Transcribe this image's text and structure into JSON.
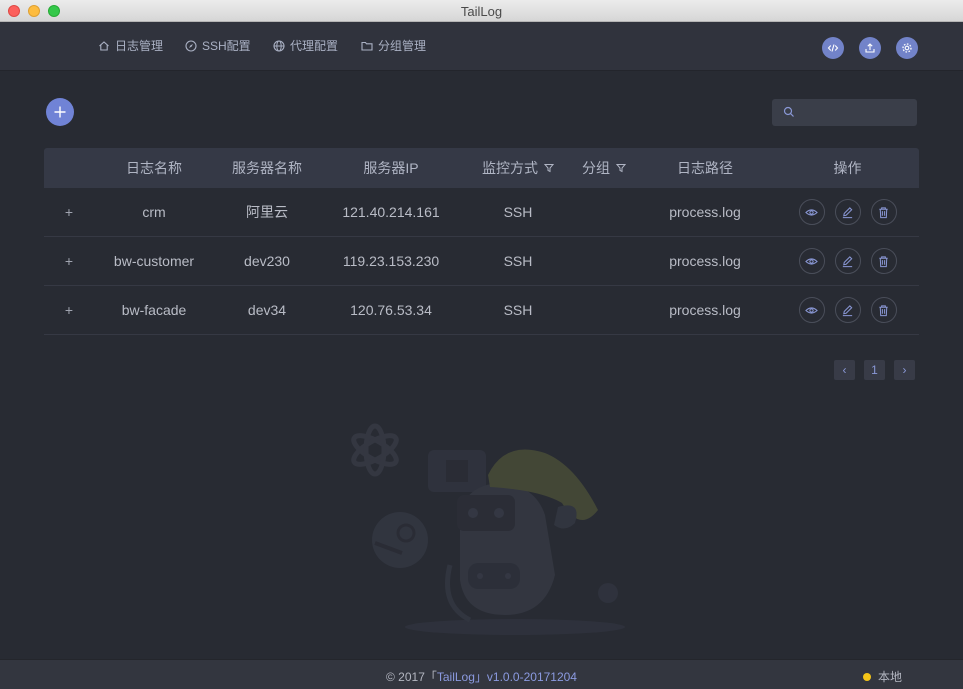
{
  "window": {
    "title": "TailLog"
  },
  "nav": [
    {
      "label": "日志管理",
      "icon": "home-icon"
    },
    {
      "label": "SSH配置",
      "icon": "compass-icon"
    },
    {
      "label": "代理配置",
      "icon": "globe-icon"
    },
    {
      "label": "分组管理",
      "icon": "folder-icon"
    }
  ],
  "header_actions": [
    "code-icon",
    "upload-icon",
    "gear-icon"
  ],
  "search": {
    "placeholder": "",
    "value": ""
  },
  "table": {
    "columns": [
      "日志名称",
      "服务器名称",
      "服务器IP",
      "监控方式",
      "分组",
      "日志路径",
      "操作"
    ],
    "rows": [
      {
        "expand": "+",
        "name": "crm",
        "server": "阿里云",
        "ip": "121.40.214.161",
        "method": "SSH",
        "group": "",
        "path": "process.log"
      },
      {
        "expand": "+",
        "name": "bw-customer",
        "server": "dev230",
        "ip": "119.23.153.230",
        "method": "SSH",
        "group": "",
        "path": "process.log"
      },
      {
        "expand": "+",
        "name": "bw-facade",
        "server": "dev34",
        "ip": "120.76.53.34",
        "method": "SSH",
        "group": "",
        "path": "process.log"
      }
    ]
  },
  "pagination": {
    "prev": "‹",
    "page": "1",
    "next": "›"
  },
  "footer": {
    "copyright_prefix": "© 2017「",
    "brand": "TailLog",
    "copyright_suffix": "」v1.0.0-20171204",
    "status_label": "本地",
    "status_color": "#f5c518"
  },
  "colors": {
    "accent": "#7083d6",
    "background": "#282b33",
    "navbar": "#30333d"
  }
}
